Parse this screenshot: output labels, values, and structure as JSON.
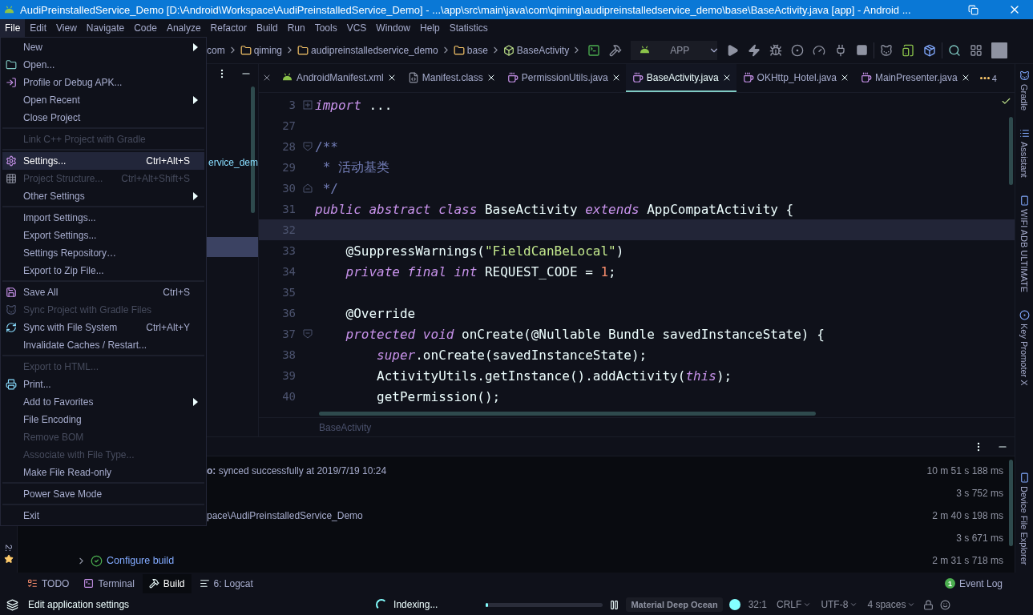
{
  "window": {
    "title": "AudiPreinstalledService_Demo [D:\\Android\\Workspace\\AudiPreinstalledService_Demo] - ...\\app\\src\\main\\java\\com\\qiming\\audipreinstalledservice_demo\\base\\BaseActivity.java [app] - Android ..."
  },
  "menu_bar": [
    {
      "label": "File",
      "selected": true
    },
    {
      "label": "Edit",
      "selected": false
    },
    {
      "label": "View",
      "selected": false
    },
    {
      "label": "Navigate",
      "selected": false
    },
    {
      "label": "Code",
      "selected": false
    },
    {
      "label": "Analyze",
      "selected": false
    },
    {
      "label": "Refactor",
      "selected": false
    },
    {
      "label": "Build",
      "selected": false
    },
    {
      "label": "Run",
      "selected": false
    },
    {
      "label": "Tools",
      "selected": false
    },
    {
      "label": "VCS",
      "selected": false
    },
    {
      "label": "Window",
      "selected": false
    },
    {
      "label": "Help",
      "selected": false
    },
    {
      "label": "Statistics",
      "selected": false
    }
  ],
  "breadcrumb": [
    {
      "label": "com",
      "kind": "plain"
    },
    {
      "label": "qiming",
      "kind": "folder"
    },
    {
      "label": "audipreinstalledservice_demo",
      "kind": "folder"
    },
    {
      "label": "base",
      "kind": "folder"
    },
    {
      "label": "BaseActivity",
      "kind": "class"
    }
  ],
  "run_config": {
    "label": "APP"
  },
  "project_panel": {
    "visible_text": "ervice_dem"
  },
  "editor": {
    "tabs": [
      {
        "label": "AndroidManifest.xml",
        "kind": "android",
        "selected": false
      },
      {
        "label": "Manifest.class",
        "kind": "class",
        "selected": false
      },
      {
        "label": "PermissionUtils.java",
        "kind": "java",
        "selected": false
      },
      {
        "label": "BaseActivity.java",
        "kind": "java",
        "selected": true
      },
      {
        "label": "OKHttp_Hotel.java",
        "kind": "java",
        "selected": false
      },
      {
        "label": "MainPresenter.java",
        "kind": "java",
        "selected": false
      }
    ],
    "more_tabs": "4",
    "lines": [
      {
        "number": "3",
        "folded": true,
        "fold_start": false,
        "fold_end": false,
        "current": false,
        "tokens": [
          {
            "kind": "keyword",
            "text": "import"
          },
          {
            "kind": "plain",
            "text": " ..."
          }
        ]
      },
      {
        "number": "27",
        "folded": false,
        "fold_start": false,
        "fold_end": false,
        "current": false
      },
      {
        "number": "28",
        "folded": false,
        "fold_start": true,
        "fold_end": false,
        "current": false,
        "tokens": [
          {
            "kind": "comment",
            "text": "/**"
          }
        ]
      },
      {
        "number": "29",
        "folded": false,
        "fold_start": false,
        "fold_end": false,
        "current": false,
        "tokens": [
          {
            "kind": "comment",
            "text": " * 活动基类"
          }
        ]
      },
      {
        "number": "30",
        "folded": false,
        "fold_start": false,
        "fold_end": true,
        "current": false,
        "tokens": [
          {
            "kind": "comment",
            "text": " */"
          }
        ]
      },
      {
        "number": "31",
        "folded": false,
        "fold_start": false,
        "fold_end": false,
        "current": false,
        "tokens": [
          {
            "kind": "keyword",
            "text": "public abstract class"
          },
          {
            "kind": "plain",
            "text": " BaseActivity "
          },
          {
            "kind": "keyword",
            "text": "extends"
          },
          {
            "kind": "plain",
            "text": " AppCompatActivity {"
          }
        ]
      },
      {
        "number": "32",
        "folded": false,
        "fold_start": false,
        "fold_end": false,
        "current": true
      },
      {
        "number": "33",
        "folded": false,
        "fold_start": false,
        "fold_end": false,
        "current": false,
        "tokens": [
          {
            "kind": "annotation",
            "text": "    @SuppressWarnings("
          },
          {
            "kind": "string",
            "text": "\"FieldCanBeLocal\""
          },
          {
            "kind": "plain",
            "text": ")"
          }
        ]
      },
      {
        "number": "34",
        "folded": false,
        "fold_start": false,
        "fold_end": false,
        "current": false,
        "tokens": [
          {
            "kind": "keyword",
            "text": "    private final int"
          },
          {
            "kind": "plain",
            "text": " REQUEST_CODE = "
          },
          {
            "kind": "number",
            "text": "1"
          },
          {
            "kind": "plain",
            "text": ";"
          }
        ]
      },
      {
        "number": "35",
        "folded": false,
        "fold_start": false,
        "fold_end": false,
        "current": false
      },
      {
        "number": "36",
        "folded": false,
        "fold_start": false,
        "fold_end": false,
        "current": false,
        "tokens": [
          {
            "kind": "annotation",
            "text": "    @Override"
          }
        ]
      },
      {
        "number": "37",
        "folded": false,
        "fold_start": true,
        "fold_end": false,
        "current": false,
        "tokens": [
          {
            "kind": "keyword",
            "text": "    protected void"
          },
          {
            "kind": "plain",
            "text": " onCreate(@Nullable Bundle savedInstanceState) {"
          }
        ]
      },
      {
        "number": "38",
        "folded": false,
        "fold_start": false,
        "fold_end": false,
        "current": false,
        "tokens": [
          {
            "kind": "keyword",
            "text": "        super"
          },
          {
            "kind": "plain",
            "text": ".onCreate(savedInstanceState);"
          }
        ]
      },
      {
        "number": "39",
        "folded": false,
        "fold_start": false,
        "fold_end": false,
        "current": false,
        "tokens": [
          {
            "kind": "plain",
            "text": "        ActivityUtils.getInstance().addActivity("
          },
          {
            "kind": "keyword",
            "text": "this"
          },
          {
            "kind": "plain",
            "text": ");"
          }
        ]
      },
      {
        "number": "40",
        "folded": false,
        "fold_start": false,
        "fold_end": false,
        "current": false,
        "tokens": [
          {
            "kind": "plain",
            "text": "        getPermission();"
          }
        ]
      }
    ],
    "breadcrumb": "BaseActivity"
  },
  "build": {
    "rows": [
      {
        "kind": "message",
        "text": "**o:** synced successfully at 2019/7/19 10:24",
        "time": "10 m 51 s 188 ms"
      },
      {
        "kind": "blank",
        "time": "3 s 752 ms"
      },
      {
        "kind": "message",
        "text": "pace\\AudiPreinstalledService_Demo",
        "time": "2 m 40 s 198 ms"
      },
      {
        "kind": "blank",
        "time": "3 s 671 ms"
      },
      {
        "kind": "task",
        "text": "Configure build",
        "time": "2 m 31 s 718 ms"
      }
    ]
  },
  "left_strip": {
    "label": "2:"
  },
  "right_strip": [
    "Gradle",
    "Assistant",
    "WIFI ADB ULTIMATE",
    "Key Promoter X",
    "Device File Explorer"
  ],
  "tool_tabs": [
    {
      "label": "TODO",
      "selected": false
    },
    {
      "label": "Terminal",
      "selected": false
    },
    {
      "label": "Build",
      "selected": true
    },
    {
      "label": "6: Logcat",
      "selected": false
    }
  ],
  "event_log": {
    "label": "Event Log",
    "count": "1"
  },
  "status_bar": {
    "message": "Edit application settings",
    "task": "Indexing...",
    "level": 0.02,
    "theme": "Material Deep Ocean",
    "position": "32:1",
    "line_separator": "CRLF",
    "encoding": "UTF-8",
    "indent": "4 spaces"
  },
  "file_menu": [
    {
      "kind": "item",
      "label": "New",
      "submenu": true,
      "disabled": false,
      "selected": false
    },
    {
      "kind": "item",
      "label": "Open...",
      "submenu": false,
      "disabled": false,
      "selected": false
    },
    {
      "kind": "item",
      "label": "Profile or Debug APK...",
      "submenu": false,
      "disabled": false,
      "selected": false
    },
    {
      "kind": "item",
      "label": "Open Recent",
      "submenu": true,
      "disabled": false,
      "selected": false
    },
    {
      "kind": "item",
      "label": "Close Project",
      "submenu": false,
      "disabled": false,
      "selected": false
    },
    {
      "kind": "separator"
    },
    {
      "kind": "item",
      "label": "Link C++ Project with Gradle",
      "submenu": false,
      "disabled": true,
      "selected": false
    },
    {
      "kind": "separator"
    },
    {
      "kind": "item",
      "label": "Settings...",
      "shortcut": "Ctrl+Alt+S",
      "submenu": false,
      "disabled": false,
      "selected": true
    },
    {
      "kind": "item",
      "label": "Project Structure...",
      "shortcut": "Ctrl+Alt+Shift+S",
      "submenu": false,
      "disabled": true,
      "selected": false
    },
    {
      "kind": "item",
      "label": "Other Settings",
      "submenu": true,
      "disabled": false,
      "selected": false
    },
    {
      "kind": "separator"
    },
    {
      "kind": "item",
      "label": "Import Settings...",
      "submenu": false,
      "disabled": false,
      "selected": false
    },
    {
      "kind": "item",
      "label": "Export Settings...",
      "submenu": false,
      "disabled": false,
      "selected": false
    },
    {
      "kind": "item",
      "label": "Settings Repository…",
      "submenu": false,
      "disabled": false,
      "selected": false
    },
    {
      "kind": "item",
      "label": "Export to Zip File...",
      "submenu": false,
      "disabled": false,
      "selected": false
    },
    {
      "kind": "separator"
    },
    {
      "kind": "item",
      "label": "Save All",
      "shortcut": "Ctrl+S",
      "submenu": false,
      "disabled": false,
      "selected": false
    },
    {
      "kind": "item",
      "label": "Sync Project with Gradle Files",
      "submenu": false,
      "disabled": true,
      "selected": false
    },
    {
      "kind": "item",
      "label": "Sync with File System",
      "shortcut": "Ctrl+Alt+Y",
      "submenu": false,
      "disabled": false,
      "selected": false
    },
    {
      "kind": "item",
      "label": "Invalidate Caches / Restart...",
      "submenu": false,
      "disabled": false,
      "selected": false
    },
    {
      "kind": "separator"
    },
    {
      "kind": "item",
      "label": "Export to HTML...",
      "submenu": false,
      "disabled": true,
      "selected": false
    },
    {
      "kind": "item",
      "label": "Print...",
      "submenu": false,
      "disabled": false,
      "selected": false
    },
    {
      "kind": "item",
      "label": "Add to Favorites",
      "submenu": true,
      "disabled": false,
      "selected": false
    },
    {
      "kind": "item",
      "label": "File Encoding",
      "submenu": false,
      "disabled": false,
      "selected": false
    },
    {
      "kind": "item",
      "label": "Remove BOM",
      "submenu": false,
      "disabled": true,
      "selected": false
    },
    {
      "kind": "item",
      "label": "Associate with File Type...",
      "submenu": false,
      "disabled": true,
      "selected": false
    },
    {
      "kind": "item",
      "label": "Make File Read-only",
      "submenu": false,
      "disabled": false,
      "selected": false
    },
    {
      "kind": "separator"
    },
    {
      "kind": "item",
      "label": "Power Save Mode",
      "submenu": false,
      "disabled": false,
      "selected": false
    },
    {
      "kind": "separator"
    },
    {
      "kind": "item",
      "label": "Exit",
      "submenu": false,
      "disabled": false,
      "selected": false
    }
  ]
}
